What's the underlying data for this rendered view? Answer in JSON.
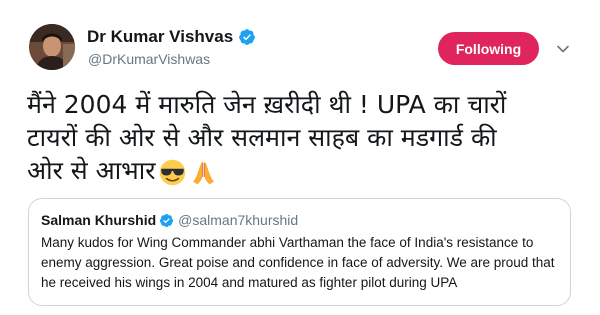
{
  "author": {
    "display_name": "Dr Kumar Vishvas",
    "handle": "@DrKumarVishwas",
    "verified": true
  },
  "follow_button": {
    "label": "Following",
    "color": "#e0245e"
  },
  "tweet": {
    "lines": [
      "मैंने 2004 में मारुति जेन ख़रीदी थी ! UPA का चारों",
      "टायरों की ओर से और सलमान साहब का मडगार्ड की",
      "ओर से आभार"
    ],
    "emojis": [
      "smiling-face-with-sunglasses",
      "folded-hands"
    ]
  },
  "quoted_tweet": {
    "display_name": "Salman Khurshid",
    "handle": "@salman7khurshid",
    "verified": true,
    "lines": [
      "Many kudos for Wing Commander abhi Varthaman the face of India's resistance to",
      "enemy aggression. Great poise and confidence in face of adversity. We are proud that",
      "he received his wings in 2004 and matured as fighter pilot during UPA"
    ]
  },
  "colors": {
    "verified_blue": "#1da1f2",
    "secondary_text": "#657786",
    "border": "#ccd6dd"
  }
}
